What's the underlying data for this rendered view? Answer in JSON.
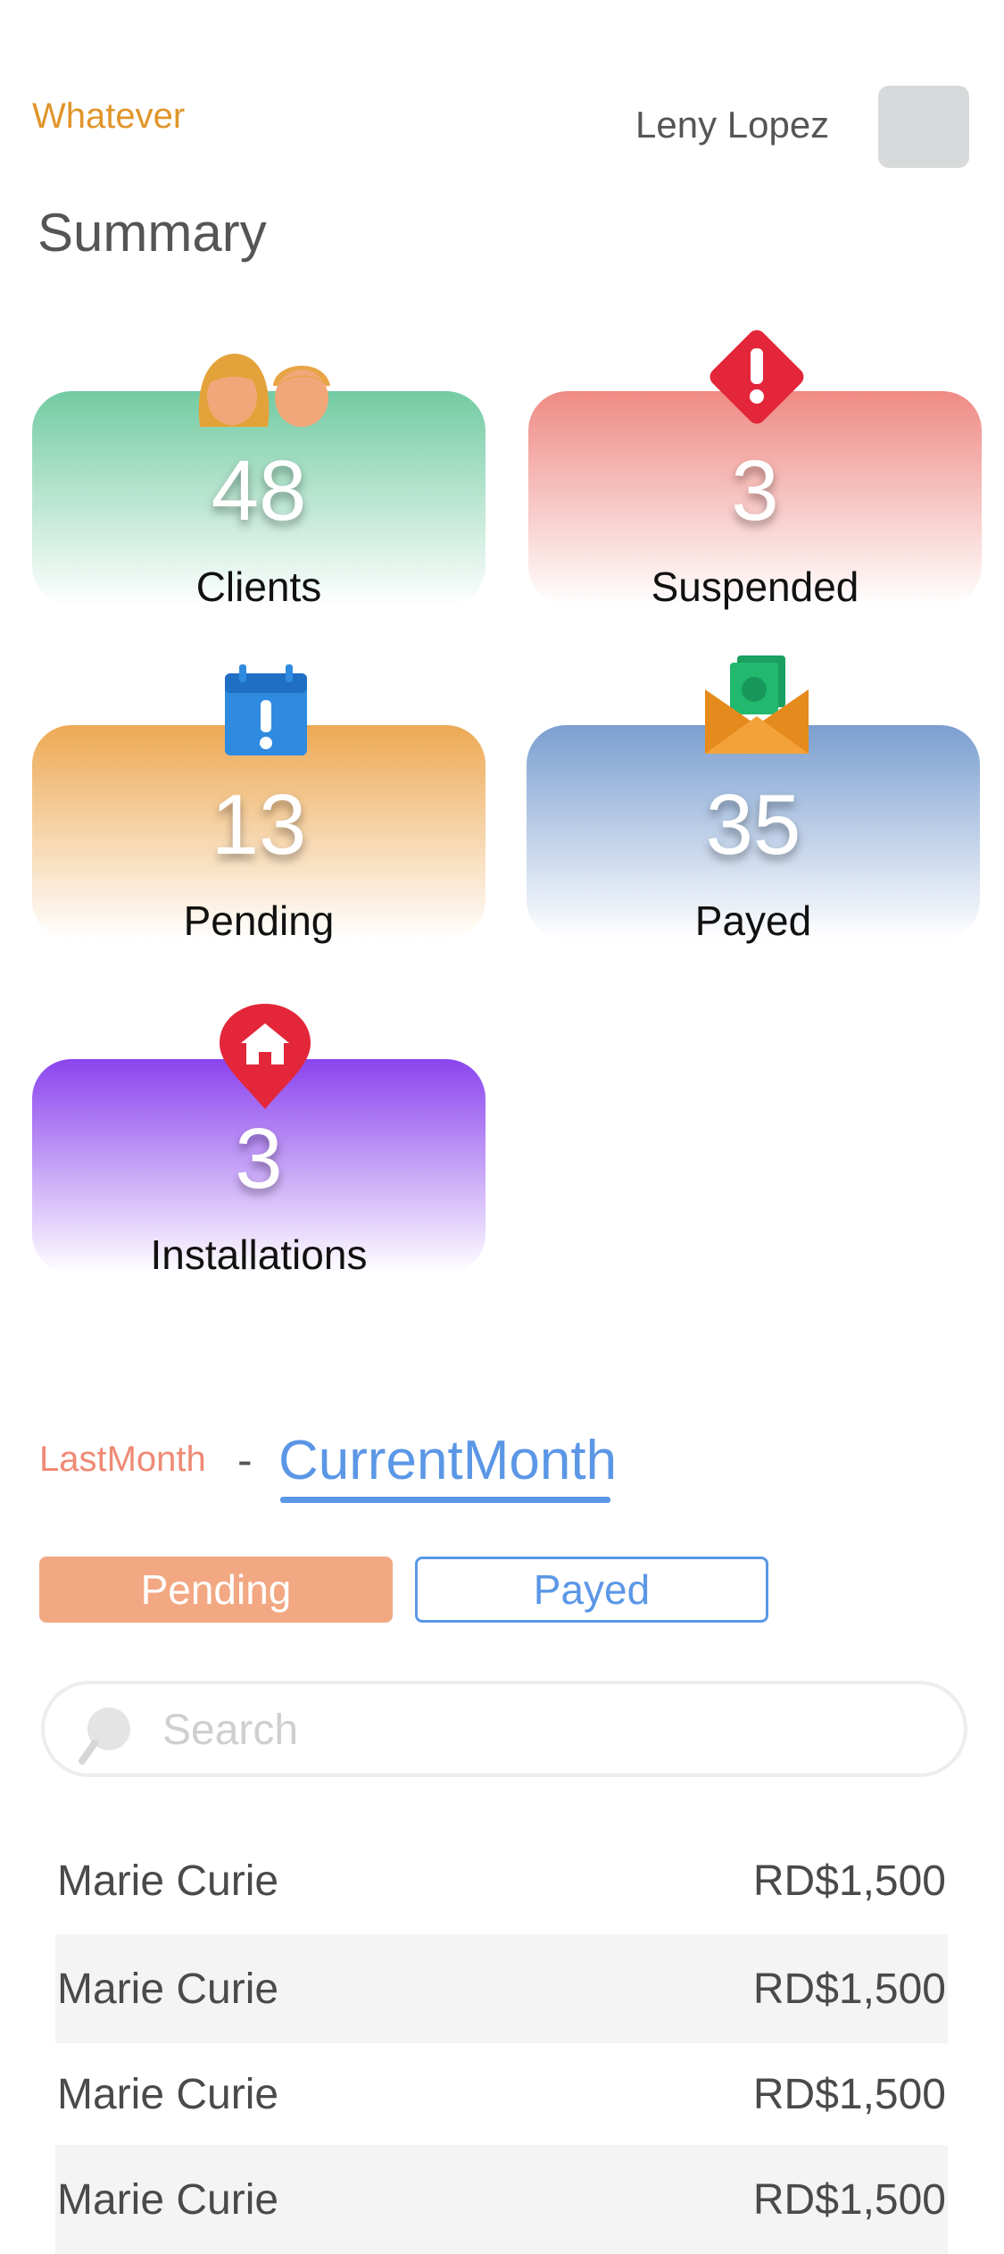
{
  "header": {
    "app_title": "Whatever",
    "user_name": "Leny Lopez"
  },
  "page_title": "Summary",
  "cards": [
    {
      "value": "48",
      "label": "Clients",
      "icon": "two-people-icon",
      "color": "#73cba3"
    },
    {
      "value": "3",
      "label": "Suspended",
      "icon": "warning-diamond-icon",
      "color": "#ef8a84"
    },
    {
      "value": "13",
      "label": "Pending",
      "icon": "calendar-alert-icon",
      "color": "#eda954"
    },
    {
      "value": "35",
      "label": "Payed",
      "icon": "money-envelope-icon",
      "color": "#7b9fd0"
    },
    {
      "value": "3",
      "label": "Installations",
      "icon": "home-pin-icon",
      "color": "#8b44ee"
    }
  ],
  "tabs": {
    "last_month": "LastMonth",
    "separator": "-",
    "current_month": "CurrentMonth",
    "active": "CurrentMonth"
  },
  "filters": {
    "pending_label": "Pending",
    "payed_label": "Payed",
    "active": "Pending"
  },
  "search": {
    "placeholder": "Search",
    "value": ""
  },
  "list": [
    {
      "name": "Marie Curie",
      "amount": "RD$1,500"
    },
    {
      "name": "Marie Curie",
      "amount": "RD$1,500"
    },
    {
      "name": "Marie Curie",
      "amount": "RD$1,500"
    },
    {
      "name": "Marie Curie",
      "amount": "RD$1,500"
    }
  ],
  "colors": {
    "accent_orange": "#e0952a",
    "accent_blue": "#5b97e6",
    "pending_button": "#f2a882",
    "last_month_text": "#ef8a74"
  }
}
